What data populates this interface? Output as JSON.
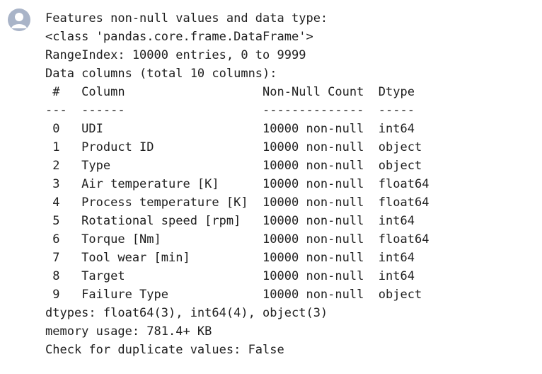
{
  "output": {
    "icon": "user-avatar-icon",
    "icon_color": "#a9b4c8",
    "lines": [
      "Features non-null values and data type:",
      "<class 'pandas.core.frame.DataFrame'>",
      "RangeIndex: 10000 entries, 0 to 9999",
      "Data columns (total 10 columns):",
      " #   Column                   Non-Null Count  Dtype  ",
      "---  ------                   --------------  -----  ",
      " 0   UDI                      10000 non-null  int64  ",
      " 1   Product ID               10000 non-null  object ",
      " 2   Type                     10000 non-null  object ",
      " 3   Air temperature [K]      10000 non-null  float64",
      " 4   Process temperature [K]  10000 non-null  float64",
      " 5   Rotational speed [rpm]   10000 non-null  int64  ",
      " 6   Torque [Nm]              10000 non-null  float64",
      " 7   Tool wear [min]          10000 non-null  int64  ",
      " 8   Target                   10000 non-null  int64  ",
      " 9   Failure Type             10000 non-null  object ",
      "dtypes: float64(3), int64(4), object(3)",
      "memory usage: 781.4+ KB",
      "Check for duplicate values: False"
    ]
  }
}
